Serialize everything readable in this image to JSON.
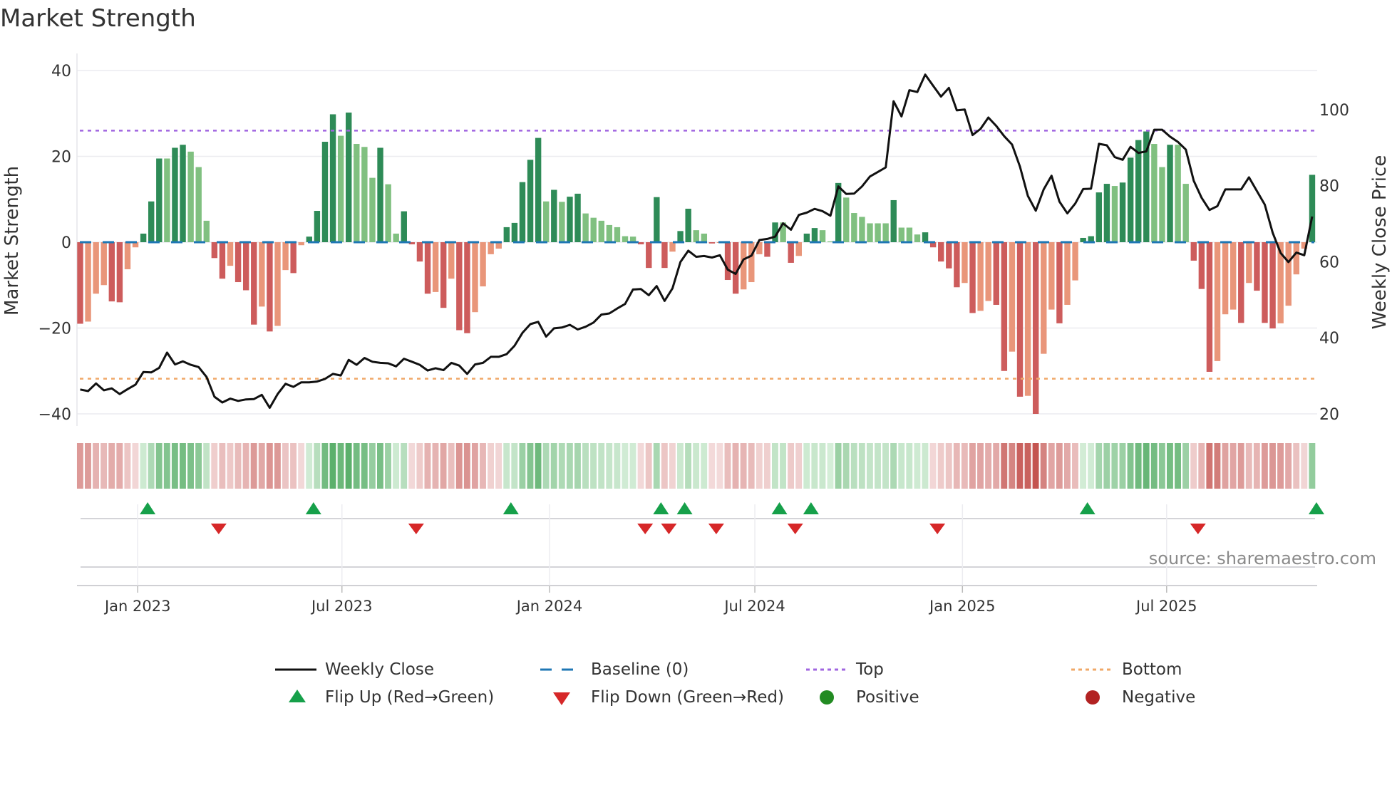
{
  "title": "Market Strength",
  "source": "source: sharemaestro.com",
  "colors": {
    "bar_up_strong": "#2e8b57",
    "bar_up_weak": "#80c080",
    "bar_down_strong": "#cd5c5c",
    "bar_down_weak": "#e9967a",
    "baseline": "#1f77b4",
    "top": "#a066e0",
    "bottom": "#f0a868",
    "close": "#111111",
    "flip_up": "#16a04a",
    "flip_down": "#d62728",
    "positive": "#228b22",
    "negative": "#b22222"
  },
  "legend": {
    "weekly_close": "Weekly Close",
    "baseline": "Baseline (0)",
    "top": "Top",
    "bottom": "Bottom",
    "flip_up": "Flip Up (Red→Green)",
    "flip_down": "Flip Down (Green→Red)",
    "positive": "Positive",
    "negative": "Negative"
  },
  "chart_data": {
    "type": "bar",
    "title": "Market Strength",
    "ylabel": "Market Strength",
    "y2label": "Weekly Close Price",
    "ylim": [
      -42,
      42
    ],
    "yticks": [
      40,
      20,
      0,
      -20,
      -40
    ],
    "ytick_labels": [
      "40",
      "20",
      "0",
      "−20",
      "−40"
    ],
    "y2ticks": [
      100,
      80,
      60,
      40,
      20
    ],
    "y2tick_labels": [
      "100",
      "80",
      "60",
      "40",
      "20"
    ],
    "x_start": "2022-11-11",
    "x_step_days": 7,
    "xticks": [
      {
        "date": "2023-01-01",
        "label": "Jan 2023"
      },
      {
        "date": "2023-07-01",
        "label": "Jul 2023"
      },
      {
        "date": "2024-01-01",
        "label": "Jan 2024"
      },
      {
        "date": "2024-07-01",
        "label": "Jul 2024"
      },
      {
        "date": "2025-01-01",
        "label": "Jan 2025"
      },
      {
        "date": "2025-07-01",
        "label": "Jul 2025"
      }
    ],
    "top_level": 26,
    "bottom_level": -31.8,
    "baseline": 0,
    "strength": [
      -19,
      -18.5,
      -12,
      -10,
      -13.8,
      -14,
      -6.3,
      -1.2,
      2,
      9.5,
      19.5,
      19.5,
      22,
      22.7,
      21.1,
      17.5,
      5,
      -3.7,
      -8.5,
      -5.5,
      -9.3,
      -11.2,
      -19.2,
      -15,
      -20.8,
      -19.5,
      -6.5,
      -7.2,
      -0.7,
      1.3,
      7.3,
      23.4,
      29.8,
      24.8,
      30.2,
      22.9,
      22.2,
      15,
      22,
      13.5,
      2,
      7.2,
      -0.5,
      -4.5,
      -12,
      -11.6,
      -15.3,
      -8.5,
      -20.5,
      -21.2,
      -16.3,
      -10.3,
      -2.8,
      -1.5,
      3.5,
      4.5,
      14,
      19.2,
      24.3,
      9.5,
      12.2,
      9.4,
      10.6,
      11.3,
      6.7,
      5.7,
      5,
      4,
      3.5,
      1.4,
      1.3,
      -0.5,
      -6,
      10.5,
      -6,
      -2.2,
      2.6,
      7.8,
      2.8,
      2,
      -0.3,
      -0.1,
      -8.8,
      -12,
      -11,
      -9.3,
      -2.8,
      -3.4,
      4.6,
      4.6,
      -4.8,
      -3.2,
      2,
      3.3,
      2.8,
      0.2,
      13.8,
      10.4,
      6.8,
      5.9,
      4.4,
      4.4,
      4.4,
      9.8,
      3.4,
      3.4,
      1.8,
      2.3,
      -1.2,
      -4.5,
      -6.1,
      -10.5,
      -9.5,
      -16.5,
      -16,
      -13.7,
      -14.6,
      -30,
      -25.5,
      -36,
      -35.8,
      -40,
      -26,
      -15.7,
      -18.9,
      -14.6,
      -8.9,
      1,
      1.4,
      11.6,
      13.6,
      13.1,
      13.9,
      19.7,
      23.8,
      25.8,
      22.9,
      17.5,
      22.7,
      22.7,
      13.6,
      -4.3,
      -10.9,
      -30.2,
      -27.7,
      -16.8,
      -15.7,
      -18.8,
      -9.5,
      -11.3,
      -18.8,
      -20.1,
      -18.9,
      -14.8,
      -7.5,
      -1.5,
      15.7
    ],
    "weekly_close": [
      26.4,
      26,
      28,
      26.2,
      26.7,
      25.2,
      26.5,
      27.7,
      31,
      30.9,
      32.1,
      36.1,
      33,
      33.8,
      32.9,
      32.3,
      29.7,
      24.5,
      23,
      24,
      23.4,
      23.8,
      23.9,
      25,
      21.6,
      25.2,
      27.9,
      27.1,
      28.3,
      28.3,
      28.5,
      29.2,
      30.5,
      30.1,
      34.2,
      32.9,
      34.7,
      33.7,
      33.4,
      33.3,
      32.5,
      34.5,
      33.7,
      32.9,
      31.4,
      32,
      31.5,
      33.4,
      32.7,
      30.5,
      33,
      33.4,
      35,
      35,
      35.7,
      37.9,
      41.3,
      43.6,
      44.2,
      40.3,
      42.5,
      42.7,
      43.4,
      42.2,
      42.9,
      44,
      46.1,
      46.4,
      47.7,
      48.9,
      52.7,
      52.8,
      51.2,
      53.6,
      49.7,
      53,
      59.9,
      62.9,
      61.3,
      61.5,
      61.1,
      61.7,
      57.9,
      56.8,
      60.6,
      61.6,
      65.7,
      66,
      66.6,
      70.1,
      68.4,
      72.3,
      72.9,
      73.9,
      73.3,
      72.1,
      79.8,
      77.8,
      77.9,
      79.8,
      82.4,
      83.6,
      84.8,
      102.2,
      98.2,
      105.1,
      104.6,
      109.2,
      106.3,
      103.4,
      105.7,
      99.8,
      100,
      93.3,
      94.9,
      97.9,
      95.7,
      93,
      90.8,
      85,
      77.3,
      73.4,
      79,
      82.6,
      75.8,
      72.7,
      75.3,
      79.1,
      79.2,
      91,
      90.6,
      87.5,
      86.8,
      90.2,
      88.6,
      89,
      94.7,
      94.7,
      92.9,
      91.5,
      89.5,
      81.3,
      76.8,
      73.6,
      74.6,
      79,
      79,
      79,
      82.2,
      78.6,
      75,
      67.6,
      62.3,
      59.9,
      62.4,
      61.7,
      71.9
    ],
    "y2lim_ref": [
      20,
      100
    ]
  }
}
